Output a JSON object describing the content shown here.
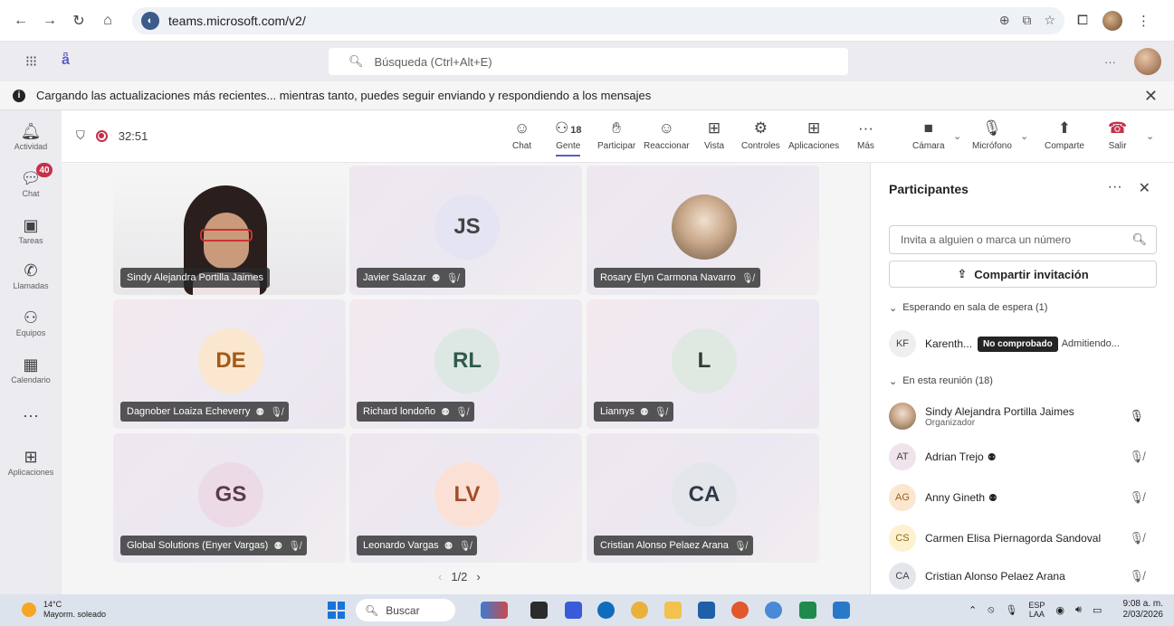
{
  "browser": {
    "url": "teams.microsoft.com/v2/",
    "nav": [
      "←",
      "→",
      "↻",
      "⌂"
    ]
  },
  "teams": {
    "search_placeholder": "Búsqueda (Ctrl+Alt+E)",
    "more": "···"
  },
  "banner": {
    "text": "Cargando las actualizaciones más recientes... mientras tanto, puedes seguir enviando y respondiendo a los mensajes"
  },
  "rail": [
    {
      "label": "Actividad",
      "icon": "bell-icon",
      "glyph": "🔔"
    },
    {
      "label": "Chat",
      "icon": "chat-icon",
      "glyph": "💬",
      "badge": "40"
    },
    {
      "label": "Tareas",
      "icon": "tasks-icon",
      "glyph": "▣"
    },
    {
      "label": "Llamadas",
      "icon": "phone-icon",
      "glyph": "✆"
    },
    {
      "label": "Equipos",
      "icon": "teams-icon",
      "glyph": "⚇"
    },
    {
      "label": "Calendario",
      "icon": "calendar-icon",
      "glyph": "▦"
    },
    {
      "label": "",
      "icon": "more-icon",
      "glyph": "···"
    },
    {
      "label": "Aplicaciones",
      "icon": "apps-icon",
      "glyph": "⊞"
    }
  ],
  "meeting": {
    "timer": "32:51",
    "toolbar": {
      "chat": "Chat",
      "people": "Gente",
      "people_count": "18",
      "raise": "Participar",
      "react": "Reaccionar",
      "view": "Vista",
      "controls": "Controles",
      "apps": "Aplicaciones",
      "more": "Más",
      "camera": "Cámara",
      "mic": "Micrófono",
      "share": "Comparte",
      "leave": "Salir"
    },
    "tiles": [
      {
        "name": "Sindy Alejandra Portilla Jaimes",
        "initials": "",
        "type": "video"
      },
      {
        "name": "Javier Salazar",
        "initials": "JS",
        "type": "avatar",
        "color": "#e5e4f3"
      },
      {
        "name": "Rosary Elyn Carmona Navarro",
        "initials": "",
        "type": "photo"
      },
      {
        "name": "Dagnober Loaiza Echeverry",
        "initials": "DE",
        "type": "avatar",
        "color": "#fbe7cf"
      },
      {
        "name": "Richard londoño",
        "initials": "RL",
        "type": "avatar",
        "color": "#dde8e4"
      },
      {
        "name": "Liannys",
        "initials": "L",
        "type": "avatar",
        "color": "#dfe8e1"
      },
      {
        "name": "Global Solutions (Enyer Vargas)",
        "initials": "GS",
        "type": "avatar",
        "color": "#ecdbe6"
      },
      {
        "name": "Leonardo Vargas",
        "initials": "LV",
        "type": "avatar",
        "color": "#fbe1d5"
      },
      {
        "name": "Cristian Alonso Pelaez Arana",
        "initials": "CA",
        "type": "avatar",
        "color": "#e3e7ec"
      }
    ],
    "pager": "1/2"
  },
  "panel": {
    "title": "Participantes",
    "invite_placeholder": "Invita a alguien o marca un número",
    "share_label": "Compartir invitación",
    "waiting_label": "Esperando en sala de espera (1)",
    "waiting": [
      {
        "initials": "KF",
        "name": "Karenth...",
        "tag": "No comprobado",
        "status": "Admitiendo..."
      }
    ],
    "in_meeting_label": "En esta reunión (18)",
    "participants": [
      {
        "initials": "",
        "name": "Sindy Alejandra Portilla Jaimes",
        "role": "Organizador",
        "mic": "on",
        "color": "photo"
      },
      {
        "initials": "AT",
        "name": "Adrian Trejo",
        "role": "",
        "mic": "muted",
        "color": "#f0e4ec"
      },
      {
        "initials": "AG",
        "name": "Anny Gineth",
        "role": "",
        "mic": "muted",
        "color": "#fbe7cf"
      },
      {
        "initials": "CS",
        "name": "Carmen Elisa Piernagorda Sandoval",
        "role": "",
        "mic": "muted",
        "color": "#fdf1cf"
      },
      {
        "initials": "CA",
        "name": "Cristian Alonso Pelaez Arana",
        "role": "",
        "mic": "muted",
        "color": "#e3e7ec"
      }
    ]
  },
  "taskbar": {
    "temp": "14°C",
    "weather": "Mayorm. soleado",
    "search": "Buscar",
    "lang_top": "ESP",
    "lang_bottom": "LAA",
    "time": "9:08 a. m.",
    "date": "2/03/2026"
  }
}
